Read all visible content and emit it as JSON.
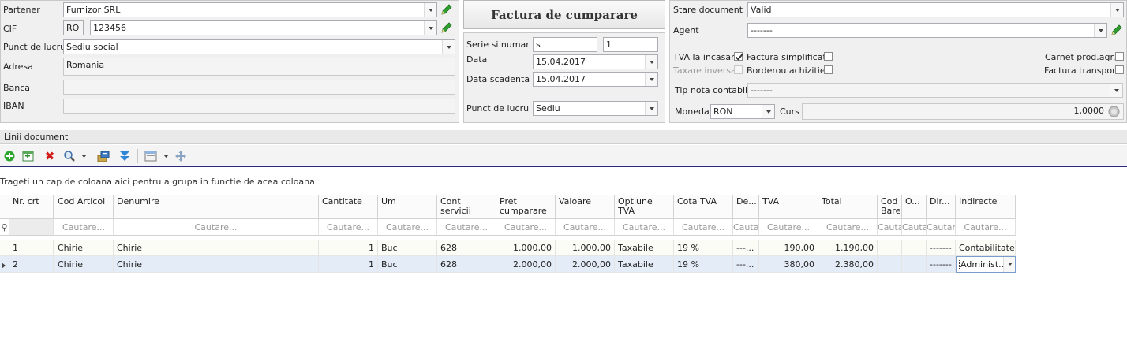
{
  "partner_section": {
    "partner_label": "Partener",
    "partner_value": "Furnizor SRL",
    "cif_label": "CIF",
    "cif_prefix": "RO",
    "cif_value": "123456",
    "work_point_label": "Punct de lucru",
    "work_point_value": "Sediu social",
    "address_label": "Adresa",
    "address_value": "Romania",
    "bank_label": "Banca",
    "bank_value": "",
    "iban_label": "IBAN",
    "iban_value": ""
  },
  "document_section": {
    "title": "Factura de cumparare",
    "series_label": "Serie si numar",
    "series_value": "s",
    "number_value": "1",
    "date_label": "Data",
    "date_value": "15.04.2017",
    "due_date_label": "Data scadenta",
    "due_date_value": "15.04.2017",
    "work_point_label": "Punct de lucru",
    "work_point_value": "Sediu"
  },
  "status_section": {
    "status_label": "Stare document",
    "status_value": "Valid",
    "agent_label": "Agent",
    "agent_value": "-------",
    "vat_on_cash_label": "TVA la incasare",
    "vat_on_cash_checked": true,
    "simplified_invoice_label": "Factura simplificata",
    "reverse_charge_label": "Taxare inversa",
    "acquisition_slip_label": "Borderou achizitie",
    "agri_card_label": "Carnet prod.agr.",
    "transport_invoice_label": "Factura transport",
    "accounting_note_label": "Tip nota contabila",
    "accounting_note_value": "-------",
    "currency_label": "Moneda",
    "currency_value": "RON",
    "rate_label": "Curs",
    "rate_value": "1,0000"
  },
  "lines_section": {
    "title": "Linii document",
    "toolbar_icons": [
      "add-icon",
      "add-row-icon",
      "delete-icon",
      "search-icon",
      "import-icon",
      "expand-icon",
      "layout-icon",
      "move-icon"
    ],
    "group_hint": "Trageti un cap de coloana aici pentru a grupa in functie de acea coloana"
  },
  "grid": {
    "columns": [
      "Nr. crt",
      "Cod Articol",
      "Denumire",
      "Cantitate",
      "Um",
      "Cont servicii",
      "Pret cumparare",
      "Valoare",
      "Optiune TVA",
      "Cota TVA",
      "De...",
      "TVA",
      "Total",
      "Cod Bare",
      "O...",
      "Dir...",
      "Indirecte"
    ],
    "filter_placeholder": "Cautare...",
    "filter_short": "Cauta",
    "filter_short2": "Cautar",
    "rows": [
      {
        "nr": "1",
        "cod": "Chirie",
        "denumire": "Chirie",
        "cantitate": "1",
        "um": "Buc",
        "cont": "628",
        "pret": "1.000,00",
        "valoare": "1.000,00",
        "optiune": "Taxabile",
        "cota": "19 %",
        "de": "---...",
        "tva": "190,00",
        "total": "1.190,00",
        "codbare": "",
        "o": "",
        "dir": "-------",
        "indirecte": "Contabilitate"
      },
      {
        "nr": "2",
        "cod": "Chirie",
        "denumire": "Chirie",
        "cantitate": "1",
        "um": "Buc",
        "cont": "628",
        "pret": "2.000,00",
        "valoare": "2.000,00",
        "optiune": "Taxabile",
        "cota": "19 %",
        "de": "---...",
        "tva": "380,00",
        "total": "2.380,00",
        "codbare": "",
        "o": "",
        "dir": "-------",
        "indirecte": "Administ..."
      }
    ]
  }
}
